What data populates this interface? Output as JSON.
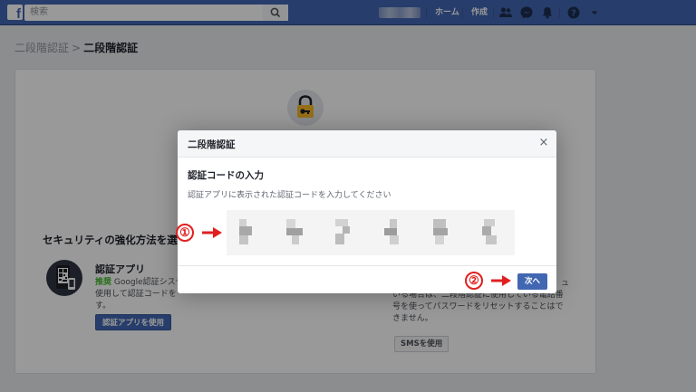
{
  "topbar": {
    "search_placeholder": "検索",
    "nav_home": "ホーム",
    "nav_create": "作成"
  },
  "breadcrumb": {
    "parent": "二段階認証",
    "separator": ">",
    "current": "二段階認証"
  },
  "page": {
    "security_title": "セキュリティの強化方法を選",
    "auth_app": {
      "title": "認証アプリ",
      "recommended": "推奨",
      "desc_line1": "Google認証システ",
      "desc_line2": "使用して認証コードを",
      "desc_line3": "す。",
      "button": "認証アプリを使用"
    },
    "sms": {
      "desc_line0": "ュ",
      "desc_line1": "いる場合は、二段階認証に使用している電話番",
      "desc_line2": "号を使ってパスワードをリセットすることはで",
      "desc_line3": "きません。",
      "button": "SMSを使用"
    }
  },
  "modal": {
    "title": "二段階認証",
    "close": "×",
    "heading": "認証コードの入力",
    "subtitle": "認証アプリに表示された認証コードを入力してください",
    "next_button": "次へ"
  },
  "annotations": {
    "marker1": "①",
    "marker2": "②",
    "color": "#e02020"
  },
  "colors": {
    "topbar": "#4267b2",
    "button_primary": "#4267b2",
    "recommended": "#42b72a"
  }
}
